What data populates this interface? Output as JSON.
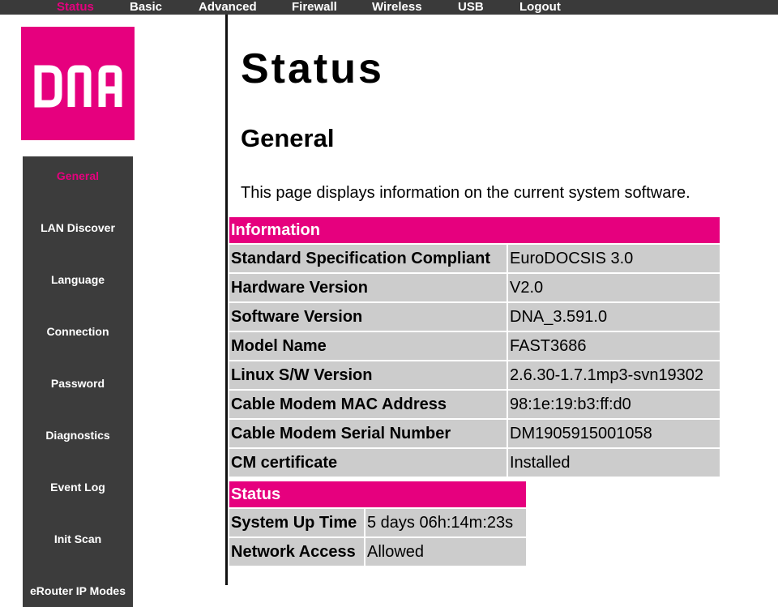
{
  "nav": {
    "items": [
      {
        "label": "Status",
        "active": true
      },
      {
        "label": "Basic",
        "active": false
      },
      {
        "label": "Advanced",
        "active": false
      },
      {
        "label": "Firewall",
        "active": false
      },
      {
        "label": "Wireless",
        "active": false
      },
      {
        "label": "USB",
        "active": false
      },
      {
        "label": "Logout",
        "active": false
      }
    ]
  },
  "logo": {
    "text": "DNA",
    "color": "#e6007e"
  },
  "sidebar": {
    "items": [
      {
        "label": "General",
        "active": true
      },
      {
        "label": "LAN Discover"
      },
      {
        "label": "Language"
      },
      {
        "label": "Connection"
      },
      {
        "label": "Password"
      },
      {
        "label": "Diagnostics"
      },
      {
        "label": "Event Log"
      },
      {
        "label": "Init Scan"
      },
      {
        "label": "eRouter IP Modes"
      }
    ]
  },
  "main": {
    "title": "Status",
    "section": "General",
    "description": "This page displays information on the current system software."
  },
  "information": {
    "header": "Information",
    "rows": [
      {
        "key": "Standard Specification Compliant",
        "value": "EuroDOCSIS 3.0"
      },
      {
        "key": "Hardware Version",
        "value": "V2.0"
      },
      {
        "key": "Software Version",
        "value": "DNA_3.591.0"
      },
      {
        "key": "Model Name",
        "value": "FAST3686"
      },
      {
        "key": "Linux S/W Version",
        "value": "2.6.30-1.7.1mp3-svn19302"
      },
      {
        "key": "Cable Modem MAC Address",
        "value": "98:1e:19:b3:ff:d0"
      },
      {
        "key": "Cable Modem Serial Number",
        "value": "DM1905915001058"
      },
      {
        "key": "CM certificate",
        "value": "Installed"
      }
    ]
  },
  "status": {
    "header": "Status",
    "rows": [
      {
        "key": "System Up Time",
        "value": "5 days 06h:14m:23s"
      },
      {
        "key": "Network Access",
        "value": "Allowed"
      }
    ]
  },
  "colors": {
    "accent": "#e6007e",
    "nav_bg": "#3a3a3a",
    "sidebar_bg": "#3c3c3c",
    "cell_bg": "#cccccc"
  }
}
